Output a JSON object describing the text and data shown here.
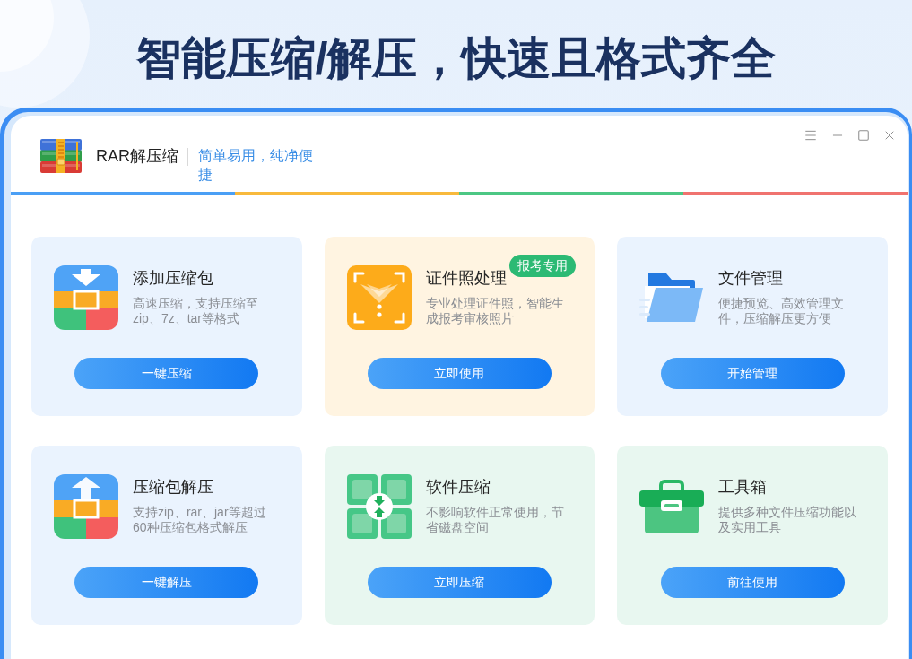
{
  "headline": "智能压缩/解压，快速且格式齐全",
  "app": {
    "name": "RAR解压缩",
    "tagline": "简单易用，纯净便捷"
  },
  "cards": [
    {
      "kind": "compress",
      "color": "#eaf3fe",
      "title": "添加压缩包",
      "description": "高速压缩，支持压缩至zip、7z、tar等格式",
      "button": "一键压缩"
    },
    {
      "kind": "id-photo",
      "color": "#fff4e1",
      "title": "证件照处理",
      "badge": "报考专用",
      "description": "专业处理证件照，智能生成报考审核照片",
      "button": "立即使用"
    },
    {
      "kind": "folder",
      "color": "#eaf3fe",
      "title": "文件管理",
      "description": "便捷预览、高效管理文件，压缩解压更方便",
      "button": "开始管理"
    },
    {
      "kind": "extract",
      "color": "#eaf3fe",
      "title": "压缩包解压",
      "description": "支持zip、rar、jar等超过60种压缩包格式解压",
      "button": "一键解压"
    },
    {
      "kind": "software",
      "color": "#e8f7f0",
      "title": "软件压缩",
      "description": "不影响软件正常使用，节省磁盘空间",
      "button": "立即压缩"
    },
    {
      "kind": "toolbox",
      "color": "#e8f7f0",
      "title": "工具箱",
      "description": "提供多种文件压缩功能以及实用工具",
      "button": "前往使用"
    }
  ]
}
